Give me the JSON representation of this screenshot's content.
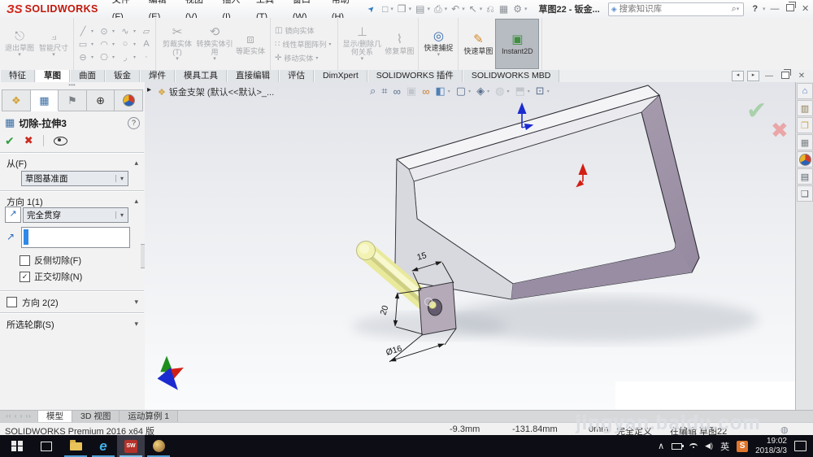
{
  "titlebar": {
    "logo_3s": "ЗS",
    "logo_text": "SOLIDWORKS",
    "menus": [
      "文件(F)",
      "编辑(E)",
      "视图(V)",
      "插入(I)",
      "工具(T)",
      "窗口(W)",
      "帮助(H)"
    ],
    "doc_title": "草图22 - 钣金...",
    "search_placeholder": "搜索知识库",
    "help_label": "?"
  },
  "quick_access": [
    {
      "name": "new-document-icon",
      "glyph": "□"
    },
    {
      "name": "open-icon",
      "glyph": "❒"
    },
    {
      "name": "save-icon",
      "glyph": "▤"
    },
    {
      "name": "print-icon",
      "glyph": "⎙"
    },
    {
      "name": "undo-icon",
      "glyph": "↶"
    },
    {
      "name": "select-icon",
      "glyph": "↖"
    },
    {
      "name": "attach-icon",
      "glyph": "⎌"
    },
    {
      "name": "rebuild-icon",
      "glyph": "▦"
    },
    {
      "name": "options-gear-icon",
      "glyph": "⚙"
    }
  ],
  "ribbon": {
    "exit_sketch": "退出草图",
    "smart_dimension": "智能尺寸",
    "sketch_icons": [
      [
        "╱",
        "⊙",
        "∿",
        "▱"
      ],
      [
        "▭",
        "◠",
        "○",
        "A"
      ],
      [
        "⊖",
        "⎔",
        "◞",
        "·"
      ]
    ],
    "trim_entities": "剪裁实体(T)",
    "convert_entities": "转换实体引用",
    "offset_entities": "等距实体",
    "mirror_entities": "镜向实体",
    "linear_pattern": "线性草图阵列",
    "move_entities": "移动实体",
    "display_delete_relations": "显示/删除几何关系",
    "repair_sketch": "修复草图",
    "quick_snaps": "快速捕捉",
    "rapid_sketch": "快速草图",
    "instant2d": "Instant2D"
  },
  "ribbon_tabs": [
    "特征",
    "草图",
    "曲面",
    "钣金",
    "焊件",
    "模具工具",
    "直接编辑",
    "评估",
    "DimXpert",
    "SOLIDWORKS 插件",
    "SOLIDWORKS MBD"
  ],
  "panel": {
    "title": "切除-拉伸3",
    "help": "?",
    "from_label": "从(F)",
    "from_value": "草图基准面",
    "dir1_label": "方向 1(1)",
    "dir1_value": "完全贯穿",
    "flip_label": "反侧切除(F)",
    "normal_label": "正交切除(N)",
    "check_glyph": "✓",
    "dir2_label": "方向 2(2)",
    "contours_label": "所选轮廓(S)"
  },
  "viewport": {
    "doc_label": "钣金支架 (默认<<默认>_...",
    "hud": [
      {
        "name": "zoom-fit-icon",
        "glyph": "⌕"
      },
      {
        "name": "zoom-area-icon",
        "glyph": "⌗"
      },
      {
        "name": "previous-view-icon",
        "glyph": "∞"
      },
      {
        "name": "section-view-icon",
        "glyph": "▣"
      },
      {
        "name": "hide-show-glasses-icon",
        "glyph": "∞"
      },
      {
        "name": "view-orientation-icon",
        "glyph": "◧"
      },
      {
        "name": "display-style-icon",
        "glyph": "▢"
      },
      {
        "name": "hide-show-items-icon",
        "glyph": "◈"
      },
      {
        "name": "appearance-icon",
        "glyph": "◍"
      },
      {
        "name": "scene-icon",
        "glyph": "⬒"
      },
      {
        "name": "view-settings-icon",
        "glyph": "⊡"
      }
    ],
    "confirm_ok": "✔",
    "confirm_cancel": "✖",
    "dim_width": "15",
    "dim_height": "20",
    "dim_dia": "Ø16",
    "watermark": "jingyan.baidu.com"
  },
  "taskpane_icons": [
    {
      "name": "home-icon",
      "glyph": "⌂"
    },
    {
      "name": "design-library-icon",
      "glyph": "▥"
    },
    {
      "name": "file-explorer-icon",
      "glyph": "❒"
    },
    {
      "name": "view-palette-icon",
      "glyph": "▦"
    },
    {
      "name": "appearances-icon",
      "glyph": ""
    },
    {
      "name": "custom-properties-icon",
      "glyph": "▤"
    },
    {
      "name": "forum-icon",
      "glyph": "❑"
    }
  ],
  "doc_tabs": [
    "模型",
    "3D 视图",
    "运动算例 1"
  ],
  "statusbar": {
    "product": "SOLIDWORKS Premium 2016 x64 版",
    "x": "-9.3mm",
    "y": "-131.84mm",
    "z": "0mm",
    "state": "完全定义",
    "editing": "在编辑 草图22"
  },
  "taskbar": {
    "ime": "英",
    "time": "19:02",
    "date": "2018/3/3",
    "sogou": "S",
    "edge": "e",
    "sw": "SW"
  },
  "colors": {
    "accent_red": "#d3261a",
    "model_purple": "#a89cab",
    "cylinder_yellow": "#ecec9d",
    "taskbar_underline": "#4f9fd4"
  }
}
